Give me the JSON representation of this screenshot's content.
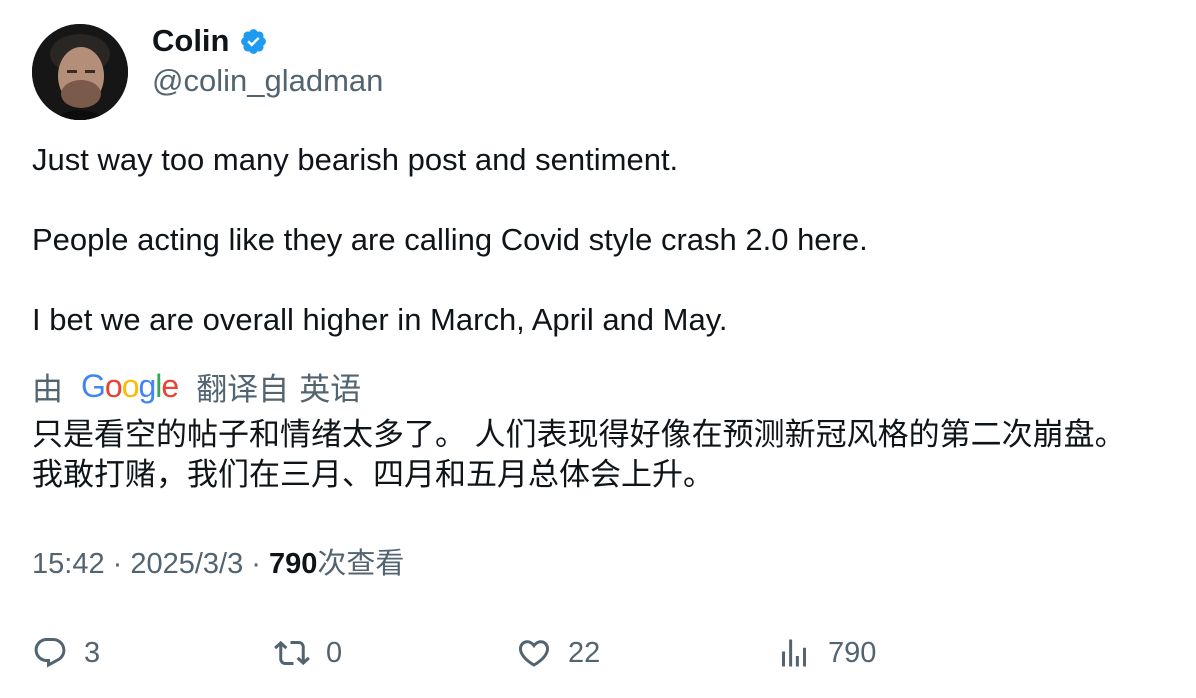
{
  "author": {
    "name": "Colin",
    "handle": "@colin_gladman",
    "verified": true
  },
  "tweet": {
    "lines": [
      "Just way too many bearish post and sentiment.",
      "People acting like they are calling Covid style crash 2.0 here.",
      "I bet we are overall higher in March, April and May."
    ]
  },
  "translation": {
    "by": "由",
    "provider": "Google",
    "provider_letters": [
      "G",
      "o",
      "o",
      "g",
      "l",
      "e"
    ],
    "from_label": "翻译自",
    "language": "英语",
    "lines": [
      "只是看空的帖子和情绪太多了。 人们表现得好像在预测新冠风格的第二次崩盘。",
      "我敢打赌，我们在三月、四月和五月总体会上升。"
    ]
  },
  "meta": {
    "time": "15:42",
    "separator": " · ",
    "date": "2025/3/3",
    "views_count": "790",
    "views_label": "次查看"
  },
  "actions": {
    "replies": "3",
    "retweets": "0",
    "likes": "22",
    "views": "790"
  },
  "colors": {
    "text_primary": "#0f1419",
    "text_secondary": "#536471",
    "verified_blue": "#1d9bf0",
    "google_blue": "#4285f4",
    "google_red": "#ea4335",
    "google_yellow": "#fbbc05",
    "google_green": "#34a853"
  },
  "icons": {
    "reply": "reply-icon",
    "retweet": "retweet-icon",
    "like": "heart-icon",
    "views": "analytics-icon",
    "verified": "verified-badge-icon"
  }
}
